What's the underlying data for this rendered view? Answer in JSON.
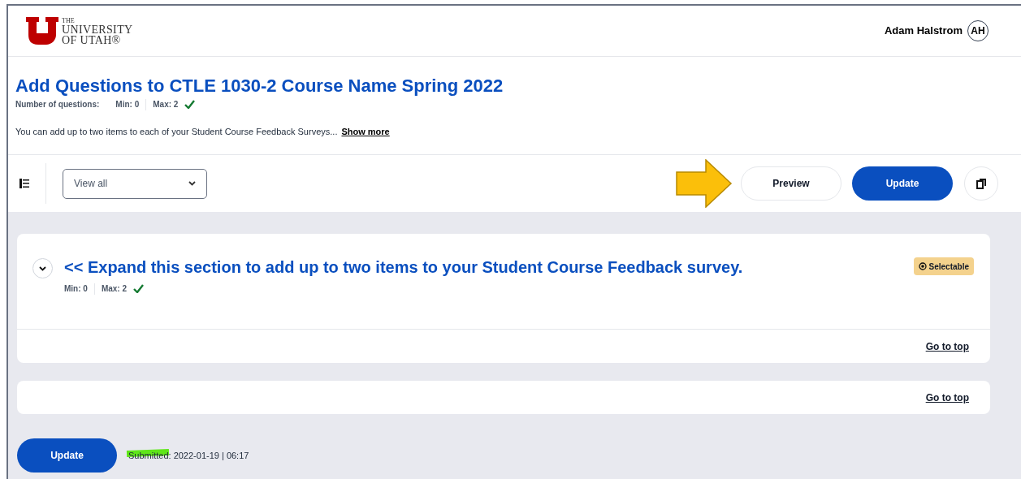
{
  "logo": {
    "lines": [
      "THE",
      "UNIVERSITY",
      "OF UTAH®"
    ]
  },
  "user": {
    "name": "Adam Halstrom",
    "initials": "AH"
  },
  "page": {
    "title": "Add Questions to CTLE 1030-2 Course Name Spring 2022",
    "count_label": "Number of questions:",
    "min": "Min: 0",
    "max": "Max: 2",
    "valid": true,
    "description": "You can add up to two items to each of your Student Course Feedback Surveys...",
    "show_more": "Show more"
  },
  "toolbar": {
    "filter": {
      "value": "View all"
    },
    "preview": "Preview",
    "update": "Update",
    "annotation_arrow": true
  },
  "sections": [
    {
      "title": "<< Expand this section to add up to two items to your Student Course Feedback survey.",
      "expanded": false,
      "min": "Min: 0",
      "max": "Max: 2",
      "valid": true,
      "badge": "Selectable",
      "go_to_top": "Go to top"
    },
    {
      "go_to_top": "Go to top"
    }
  ],
  "footer": {
    "update": "Update",
    "submitted_label": "Submitted",
    "submitted_rest": ": 2022-01-19 | 06:17",
    "highlighted": true
  }
}
